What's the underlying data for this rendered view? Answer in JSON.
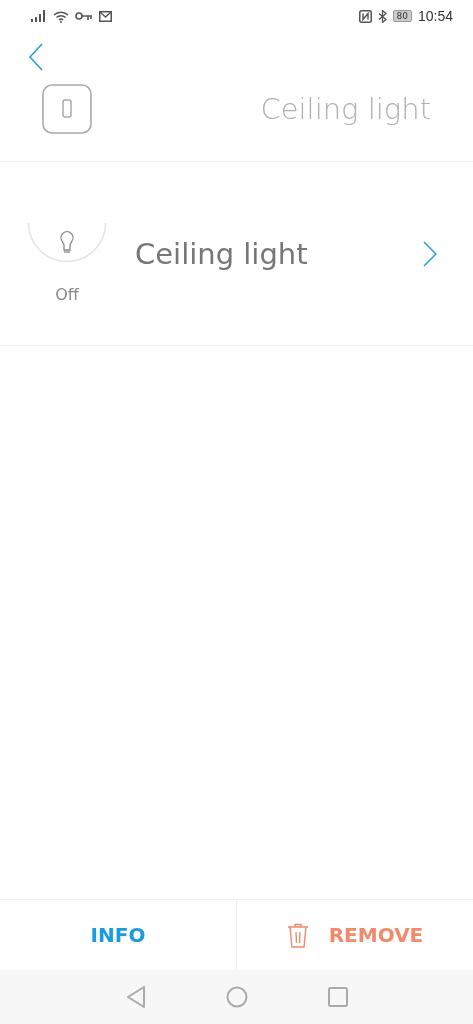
{
  "status_bar": {
    "battery": "80",
    "time": "10:54"
  },
  "header": {
    "title": "Ceiling light"
  },
  "devices": [
    {
      "name": "Ceiling light",
      "state": "Off"
    }
  ],
  "actions": {
    "info": "INFO",
    "remove": "REMOVE"
  }
}
